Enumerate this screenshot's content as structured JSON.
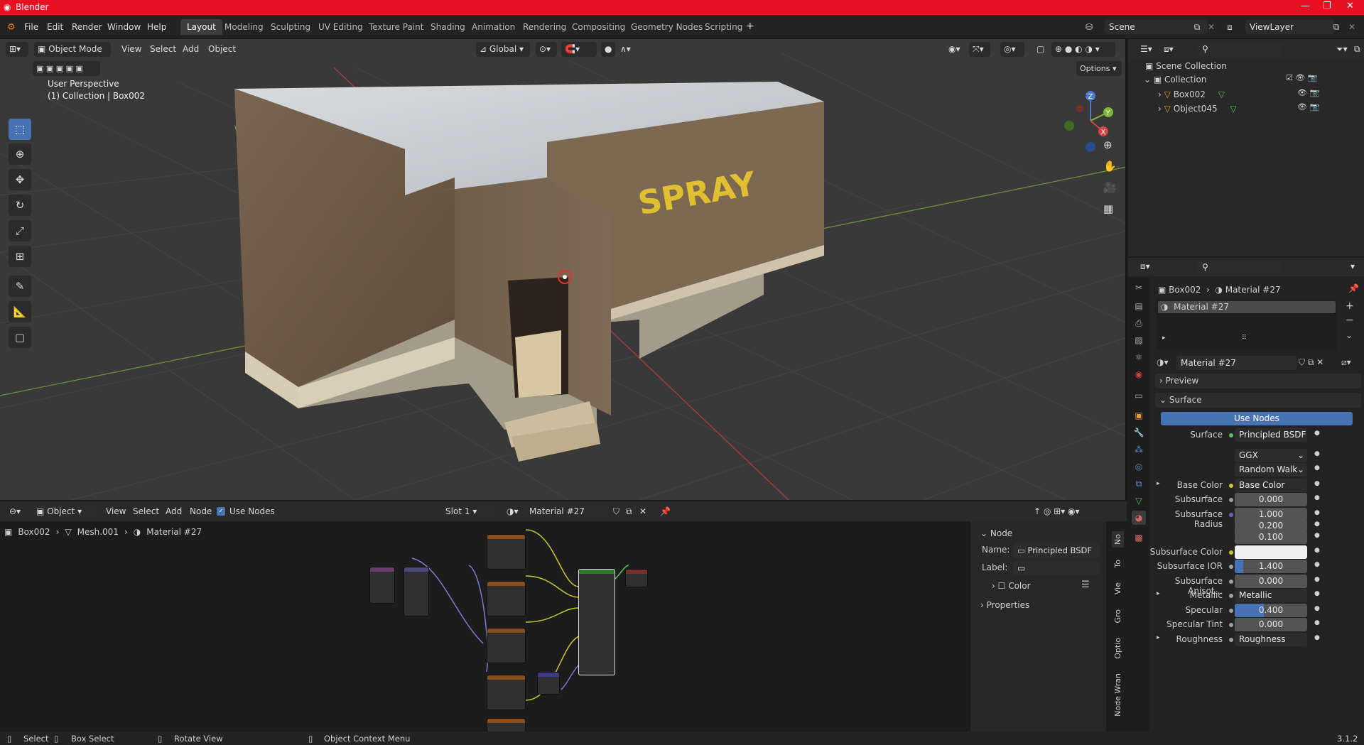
{
  "window": {
    "title": "Blender",
    "version": "3.1.2"
  },
  "menu": [
    "File",
    "Edit",
    "Render",
    "Window",
    "Help"
  ],
  "workspaces": [
    "Layout",
    "Modeling",
    "Sculpting",
    "UV Editing",
    "Texture Paint",
    "Shading",
    "Animation",
    "Rendering",
    "Compositing",
    "Geometry Nodes",
    "Scripting"
  ],
  "active_workspace": "Layout",
  "scene_field": "Scene",
  "viewlayer_field": "ViewLayer",
  "viewport": {
    "mode": "Object Mode",
    "menus": [
      "View",
      "Select",
      "Add",
      "Object"
    ],
    "transform_orientation": "Global",
    "options_label": "Options",
    "overlay_line1": "User Perspective",
    "overlay_line2": "(1) Collection | Box002",
    "axes": {
      "x": "X",
      "y": "Y",
      "z": "Z"
    },
    "graffiti_text": "SPRAY"
  },
  "outliner": {
    "root": "Scene Collection",
    "collection": "Collection",
    "objects": [
      "Box002",
      "Object045"
    ]
  },
  "properties": {
    "breadcrumb_object": "Box002",
    "breadcrumb_material": "Material #27",
    "slot_item": "Material #27",
    "material_field": "Material #27",
    "preview_label": "Preview",
    "surface_label": "Surface",
    "use_nodes_label": "Use Nodes",
    "rows": [
      {
        "label": "Surface",
        "value": "Principled BSDF",
        "dot": "#5fbf5f"
      },
      {
        "label": "",
        "value": "GGX",
        "kind": "dropdown"
      },
      {
        "label": "",
        "value": "Random Walk",
        "kind": "dropdown"
      },
      {
        "label": "Base Color",
        "value": "Base Color",
        "dot": "#c7c729",
        "expand": true
      },
      {
        "label": "Subsurface",
        "value": "0.000",
        "dot": "#a1a1a1"
      },
      {
        "label": "Subsurface Radius",
        "value": "1.000",
        "dot": "#6363c7"
      },
      {
        "label": "",
        "value": "0.200"
      },
      {
        "label": "",
        "value": "0.100"
      },
      {
        "label": "Subsurface Color",
        "value": "",
        "dot": "#c7c729",
        "kind": "color"
      },
      {
        "label": "Subsurface IOR",
        "value": "1.400",
        "dot": "#a1a1a1",
        "fill": 0.12
      },
      {
        "label": "Subsurface Anisot...",
        "value": "0.000",
        "dot": "#a1a1a1"
      },
      {
        "label": "Metallic",
        "value": "Metallic",
        "dot": "#a1a1a1",
        "expand": true
      },
      {
        "label": "Specular",
        "value": "0.400",
        "dot": "#a1a1a1",
        "fill": 0.4
      },
      {
        "label": "Specular Tint",
        "value": "0.000",
        "dot": "#a1a1a1"
      },
      {
        "label": "Roughness",
        "value": "Roughness",
        "dot": "#a1a1a1",
        "expand": true
      }
    ]
  },
  "node_editor": {
    "type_label": "Object",
    "menus": [
      "View",
      "Select",
      "Add",
      "Node"
    ],
    "use_nodes": "Use Nodes",
    "slot": "Slot 1",
    "material": "Material #27",
    "breadcrumb": [
      "Box002",
      "Mesh.001",
      "Material #27"
    ],
    "npanel": {
      "section": "Node",
      "name_label": "Name:",
      "name_value": "Principled BSDF",
      "label_label": "Label:",
      "color_label": "Color",
      "properties_label": "Properties"
    },
    "side_tabs": [
      "No",
      "To",
      "Vie",
      "Gro",
      "Optio",
      "Node Wran"
    ]
  },
  "statusbar": {
    "select": "Select",
    "box_select": "Box Select",
    "rotate": "Rotate View",
    "context": "Object Context Menu"
  },
  "colors": {
    "accent": "#4772b3",
    "titlebar": "#e81123",
    "header": "#232323"
  }
}
